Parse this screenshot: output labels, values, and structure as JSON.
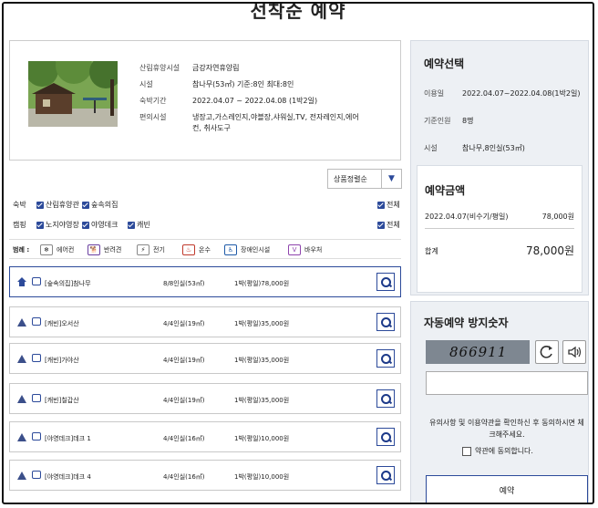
{
  "page_title": "선착순 예약",
  "facility": {
    "rows": [
      {
        "label": "산림휴양시설",
        "value": "금강자연휴양림"
      },
      {
        "label": "시설",
        "value": "참나무(53㎡) 기준:8인 최대:8인"
      },
      {
        "label": "숙박기간",
        "value": "2022.04.07 ~ 2022.04.08 (1박2일)"
      },
      {
        "label": "편의시설",
        "value": "냉장고,가스레인지,야블장,샤워실,TV, 전자레인지,에어컨, 취사도구"
      }
    ]
  },
  "sort": {
    "selected": "상품정렬순"
  },
  "filters": [
    {
      "category": "숙박",
      "options": [
        "산림휴양관",
        "숲속의집"
      ],
      "all_label": "전체"
    },
    {
      "category": "캠핑",
      "options": [
        "노지야영장",
        "야영데크",
        "캐빈"
      ],
      "all_label": "전체"
    }
  ],
  "legend": {
    "title": "범례 :",
    "items": [
      {
        "label": "에어컨",
        "icon": "air-conditioner-icon"
      },
      {
        "label": "반려견",
        "icon": "pet-dog-icon"
      },
      {
        "label": "전기",
        "icon": "electricity-icon"
      },
      {
        "label": "온수",
        "icon": "hot-water-icon"
      },
      {
        "label": "장애인시설",
        "icon": "accessibility-icon"
      },
      {
        "label": "바우처",
        "icon": "voucher-icon"
      }
    ]
  },
  "rows": [
    {
      "name": "[숲속의집]참나무",
      "capacity": "8/8인실(53㎡)",
      "price": "1박(평일)78,000원",
      "status_icon": "house-icon"
    },
    {
      "name": "[캐빈]오서산",
      "capacity": "4/4인실(19㎡)",
      "price": "1박(평일)35,000원",
      "status_icon": "warning-icon"
    },
    {
      "name": "[캐빈]가야산",
      "capacity": "4/4인실(19㎡)",
      "price": "1박(평일)35,000원",
      "status_icon": "warning-icon"
    },
    {
      "name": "[캐빈]칠갑산",
      "capacity": "4/4인실(19㎡)",
      "price": "1박(평일)35,000원",
      "status_icon": "warning-icon"
    },
    {
      "name": "[야영데크]데크 1",
      "capacity": "4/4인실(16㎡)",
      "price": "1박(평일)10,000원",
      "status_icon": "warning-icon"
    },
    {
      "name": "[야영데크]데크 4",
      "capacity": "4/4인실(16㎡)",
      "price": "1박(평일)10,000원",
      "status_icon": "warning-icon"
    }
  ],
  "selection": {
    "title": "예약선택",
    "rows": [
      {
        "label": "이용일",
        "value": "2022.04.07~2022.04.08(1박2일)"
      },
      {
        "label": "기준인원",
        "value": "8명"
      },
      {
        "label": "시설",
        "value": "참나무,8인실(53㎡)"
      }
    ]
  },
  "amount": {
    "title": "예약금액",
    "line_label": "2022.04.07(비수기/평일)",
    "line_value": "78,000원",
    "total_label": "합계",
    "total_value": "78,000원"
  },
  "captcha": {
    "title": "자동예약 방지숫자",
    "code": "866911",
    "input_value": "",
    "notice": "유의사항 및 이용약관을 확인하신 후 동의하시면 체크해주세요.",
    "agree_label": "약관에 동의합니다.",
    "reserve_label": "예약"
  },
  "colors": {
    "accent": "#2c4a9a",
    "panel_bg": "#edf0f4",
    "captcha_bg": "#7e8791"
  }
}
